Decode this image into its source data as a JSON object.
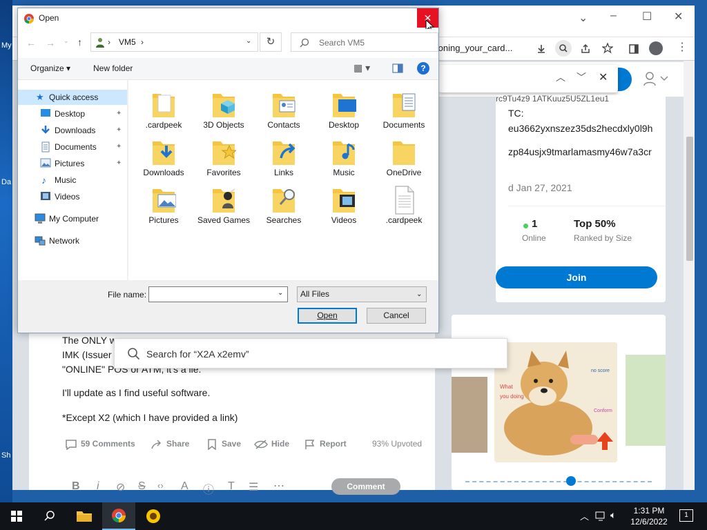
{
  "desktop": {
    "edge_labels": [
      "My",
      "Da",
      "Sh"
    ]
  },
  "browser": {
    "url_fragment": "_cloning_your_card...",
    "window_controls": [
      "–",
      "☐",
      "✕"
    ]
  },
  "reddit": {
    "join_button": "Join",
    "sidecard": {
      "line1": "TC:",
      "line2": "eu3662yxnszez35ds2hecdxly0l9h",
      "line3": "zp84usjx9tmarlamasmy46w7a3cr",
      "created": "d Jan 27, 2021",
      "online_count": "1",
      "online_label": "Online",
      "rank_value": "Top 50%",
      "rank_label": "Ranked by Size"
    },
    "post": {
      "line1": "The ONLY w",
      "line2": "IMK (Issuer",
      "line3": "\"ONLINE\" POS or ATM, it's a lie.",
      "line4": "I'll update as I find useful software.",
      "line5": "*Except X2 (which I have provided a link)",
      "comments": "59 Comments",
      "share": "Share",
      "save": "Save",
      "hide": "Hide",
      "report": "Report",
      "upvoted": "93% Upvoted",
      "comment_button": "Comment"
    },
    "search_popup": "Search for “X2A x2emv”",
    "meme_text": {
      "a": "What",
      "b": "you doing",
      "c": "no score",
      "d": "Conform"
    }
  },
  "dialog": {
    "title": "Open",
    "close": "✕",
    "breadcrumb": [
      "VM5"
    ],
    "search_placeholder": "Search VM5",
    "organize": "Organize",
    "new_folder": "New folder",
    "nav": {
      "quick_access": "Quick access",
      "items": [
        "Desktop",
        "Downloads",
        "Documents",
        "Pictures",
        "Music",
        "Videos"
      ],
      "my_computer": "My Computer",
      "network": "Network"
    },
    "files": [
      ".cardpeek",
      "3D Objects",
      "Contacts",
      "Desktop",
      "Documents",
      "Downloads",
      "Favorites",
      "Links",
      "Music",
      "OneDrive",
      "Pictures",
      "Saved Games",
      "Searches",
      "Videos",
      ".cardpeek"
    ],
    "file_name_label": "File name:",
    "file_name_value": "",
    "file_type": "All Files",
    "open_button": "Open",
    "cancel_button": "Cancel"
  },
  "taskbar": {
    "time": "1:31 PM",
    "date": "12/6/2022",
    "notifications": "1"
  }
}
